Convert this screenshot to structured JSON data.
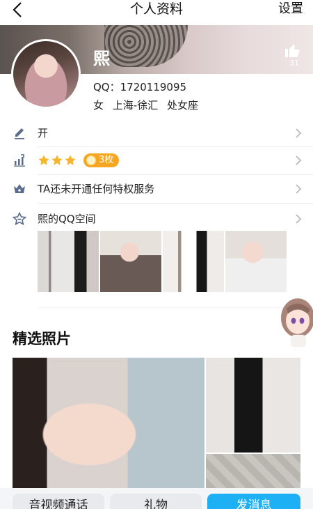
{
  "nav": {
    "title": "个人资料",
    "settings_label": "设置"
  },
  "profile": {
    "nickname": "熙",
    "likes": "31",
    "qq": "QQ：1720119095",
    "gender": "女",
    "location": "上海-徐汇",
    "zodiac": "处女座"
  },
  "rows": {
    "signature": "开",
    "coins": "3枚",
    "privilege": "TA还未开通任何特权服务",
    "qzone": "熙的QQ空间"
  },
  "featured": {
    "title": "精选照片"
  },
  "bottom": {
    "call": "音视频通话",
    "gift": "礼物",
    "message": "发消息"
  },
  "colors": {
    "accent": "#1eb0f5",
    "badge": "#f5a623",
    "star": "#f7b52c"
  }
}
